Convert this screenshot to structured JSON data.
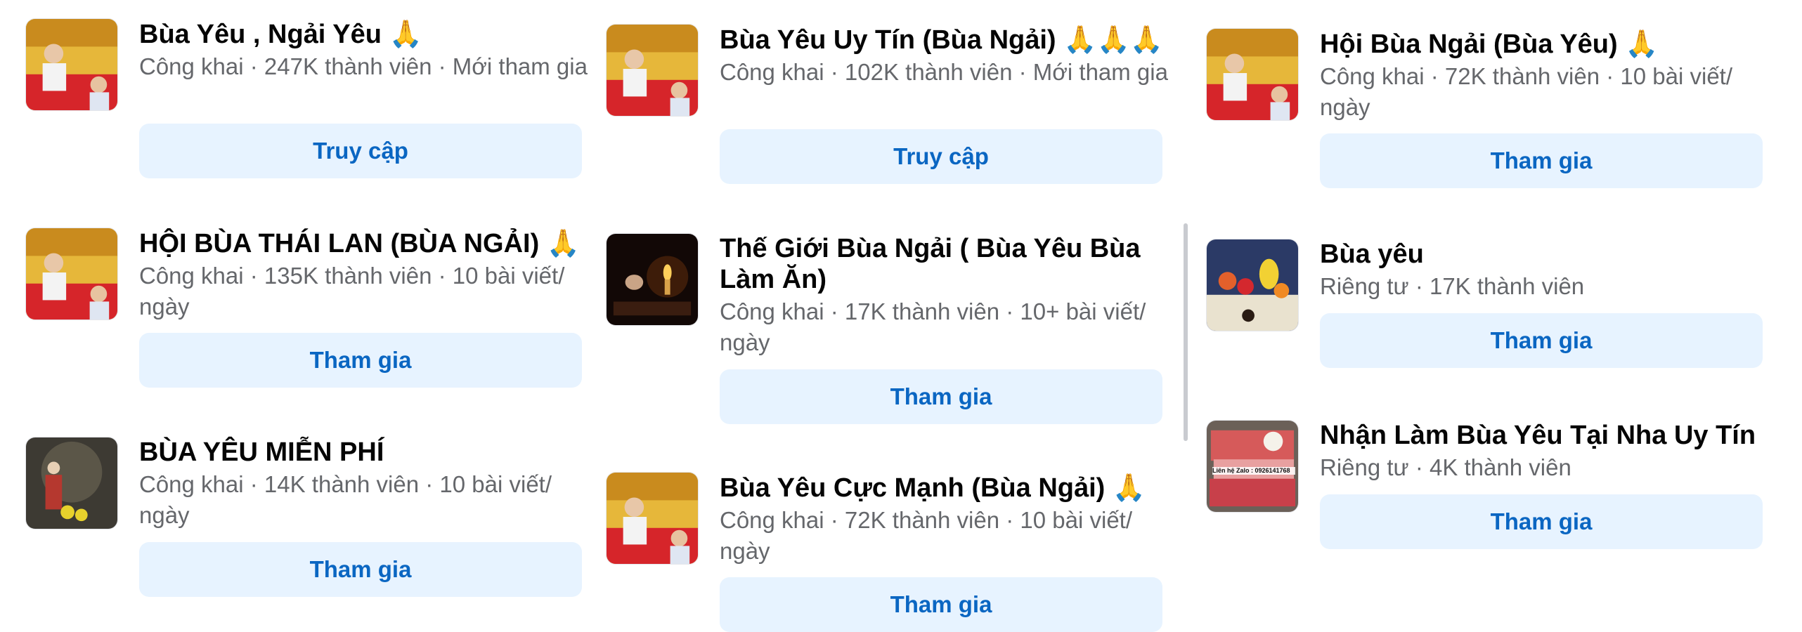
{
  "columns": [
    {
      "cards": [
        {
          "title": "Bùa Yêu , Ngải Yêu ",
          "emoji": "🙏",
          "meta": "Công khai · 247K thành viên · Mới tham gia",
          "button": "Truy cập",
          "thumb": "shop-altar-photo"
        },
        {
          "title": "HỘI BÙA THÁI LAN (BÙA NGẢI) ",
          "emoji": "🙏",
          "meta": "Công khai · 135K thành viên · 10 bài viết/ ngày",
          "button": "Tham gia",
          "thumb": "shop-altar-photo"
        },
        {
          "title": "BÙA YÊU MIỄN PHÍ",
          "emoji": "",
          "meta": "Công khai · 14K thành viên · 10 bài viết/ ngày",
          "button": "Tham gia",
          "thumb": "statue-photo"
        }
      ]
    },
    {
      "cards": [
        {
          "title": "Bùa Yêu Uy Tín (Bùa Ngải) ",
          "emoji": "🙏🙏🙏",
          "meta": "Công khai · 102K thành viên · Mới tham gia",
          "button": "Truy cập",
          "thumb": "shop-altar-photo"
        },
        {
          "title": "Thế Giới Bùa Ngải ( Bùa Yêu Bùa Làm Ăn)",
          "emoji": "",
          "meta": "Công khai · 17K thành viên · 10+ bài viết/ ngày",
          "button": "Tham gia",
          "thumb": "candle-skull-photo"
        },
        {
          "title": "Bùa Yêu Cực Mạnh (Bùa Ngải) ",
          "emoji": "🙏",
          "meta": "Công khai · 72K thành viên · 10 bài viết/ ngày",
          "button": "Tham gia",
          "thumb": "shop-altar-photo"
        }
      ]
    },
    {
      "cards": [
        {
          "title": "Hội Bùa Ngải (Bùa Yêu) ",
          "emoji": "🙏",
          "meta": "Công khai · 72K thành viên · 10 bài viết/ ngày",
          "button": "Tham gia",
          "thumb": "shop-altar-photo"
        },
        {
          "title": "Bùa yêu",
          "emoji": "",
          "meta": "Riêng tư · 17K thành viên",
          "button": "Tham gia",
          "thumb": "offering-table-photo"
        },
        {
          "title": "Nhận Làm Bùa Yêu Tại Nha Uy Tín",
          "emoji": "",
          "meta": "Riêng tư · 4K thành viên",
          "button": "Tham gia",
          "thumb": "money-phone-photo",
          "thumb_text": "Liên hệ Zalo : 0926141768"
        }
      ]
    }
  ],
  "colors": {
    "button_bg": "#e7f3ff",
    "button_text": "#0a66c2",
    "meta_text": "#65676b"
  }
}
